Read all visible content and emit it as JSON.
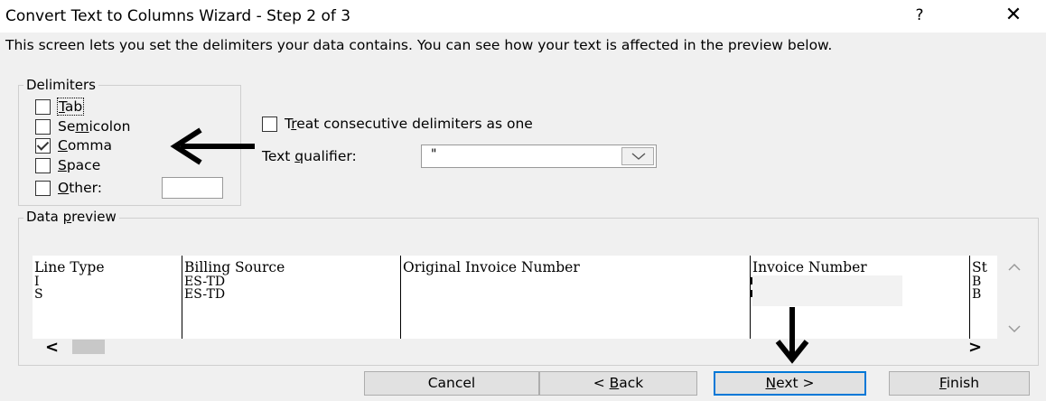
{
  "window": {
    "title": "Convert Text to Columns Wizard - Step 2 of 3",
    "help_label": "?",
    "close_label": "✕"
  },
  "description": "This screen lets you set the delimiters your data contains.  You can see how your text is affected in the preview below.",
  "delimiters": {
    "legend": "Delimiters",
    "options": [
      {
        "pre": "",
        "key": "T",
        "post": "ab",
        "checked": false
      },
      {
        "pre": "Se",
        "key": "m",
        "post": "icolon",
        "checked": false
      },
      {
        "pre": "",
        "key": "C",
        "post": "omma",
        "checked": true
      },
      {
        "pre": "",
        "key": "S",
        "post": "pace",
        "checked": false
      },
      {
        "pre": "",
        "key": "O",
        "post": "ther:",
        "checked": false
      }
    ],
    "other_value": ""
  },
  "consecutive": {
    "pre": "T",
    "key": "r",
    "post": "eat consecutive delimiters as one",
    "checked": false
  },
  "text_qualifier": {
    "pre": "Text ",
    "key": "q",
    "post": "ualifier:",
    "value": "\""
  },
  "preview": {
    "legend_pre": "Data ",
    "legend_key": "p",
    "legend_post": "review",
    "columns": [
      {
        "header": "Line Type",
        "cells": [
          "I",
          "S"
        ]
      },
      {
        "header": "Billing Source",
        "cells": [
          "ES-TD",
          "ES-TD"
        ]
      },
      {
        "header": "Original Invoice Number",
        "cells": [
          "",
          ""
        ]
      },
      {
        "header": "Invoice Number",
        "cells": [
          "",
          ""
        ]
      },
      {
        "header": "St",
        "cells": [
          "B",
          "B"
        ]
      }
    ]
  },
  "buttons": {
    "cancel": "Cancel",
    "back": {
      "pre": "< ",
      "key": "B",
      "post": "ack"
    },
    "next": {
      "pre": "",
      "key": "N",
      "post": "ext >"
    },
    "finish": {
      "pre": "",
      "key": "F",
      "post": "inish"
    }
  },
  "colors": {
    "accent": "#0078d7",
    "background": "#f0f0f0"
  },
  "icons": {
    "scroll_left": "<",
    "scroll_right": ">",
    "dropdown": "chevron-down-icon"
  }
}
